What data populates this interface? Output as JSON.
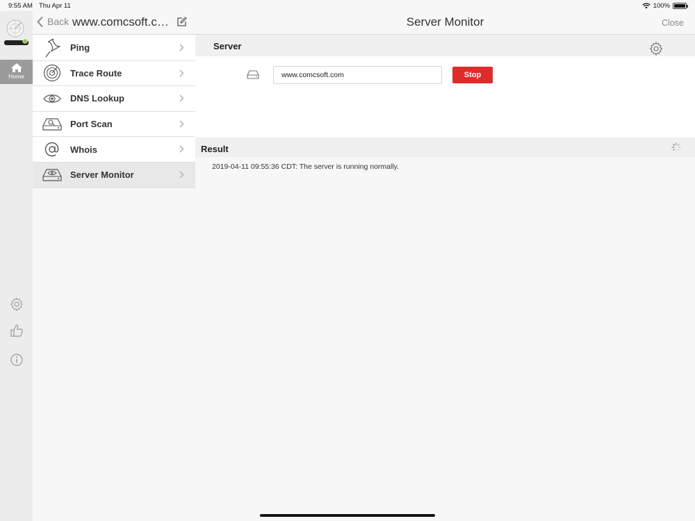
{
  "status_bar": {
    "time": "9:55 AM",
    "date": "Thu Apr 11",
    "battery": "100%"
  },
  "rail": {
    "home_label": "Home",
    "icons": [
      "app-logo-icon",
      "home-icon",
      "settings-icon",
      "thumbs-up-icon",
      "info-icon"
    ]
  },
  "nav": {
    "back_label": "Back",
    "title": "www.comcsoft.com",
    "items": [
      {
        "label": "Ping",
        "icon": "pushpin-icon"
      },
      {
        "label": "Trace Route",
        "icon": "radar-icon"
      },
      {
        "label": "DNS Lookup",
        "icon": "eye-icon"
      },
      {
        "label": "Port Scan",
        "icon": "drive-search-icon"
      },
      {
        "label": "Whois",
        "icon": "at-sign-icon"
      },
      {
        "label": "Server Monitor",
        "icon": "drive-eye-icon",
        "selected": true
      }
    ]
  },
  "main": {
    "title": "Server Monitor",
    "close_label": "Close",
    "server": {
      "section_label": "Server",
      "host_value": "www.comcsoft.com",
      "stop_label": "Stop"
    },
    "result": {
      "section_label": "Result",
      "lines": [
        "2019-04-11 09:55:36 CDT: The server is running normally."
      ]
    }
  },
  "colors": {
    "stop_button": "#e02b2b",
    "selected_row": "#e8e8e8",
    "home_tab": "#9a9a9a",
    "status_dot": "#8bc34a"
  }
}
